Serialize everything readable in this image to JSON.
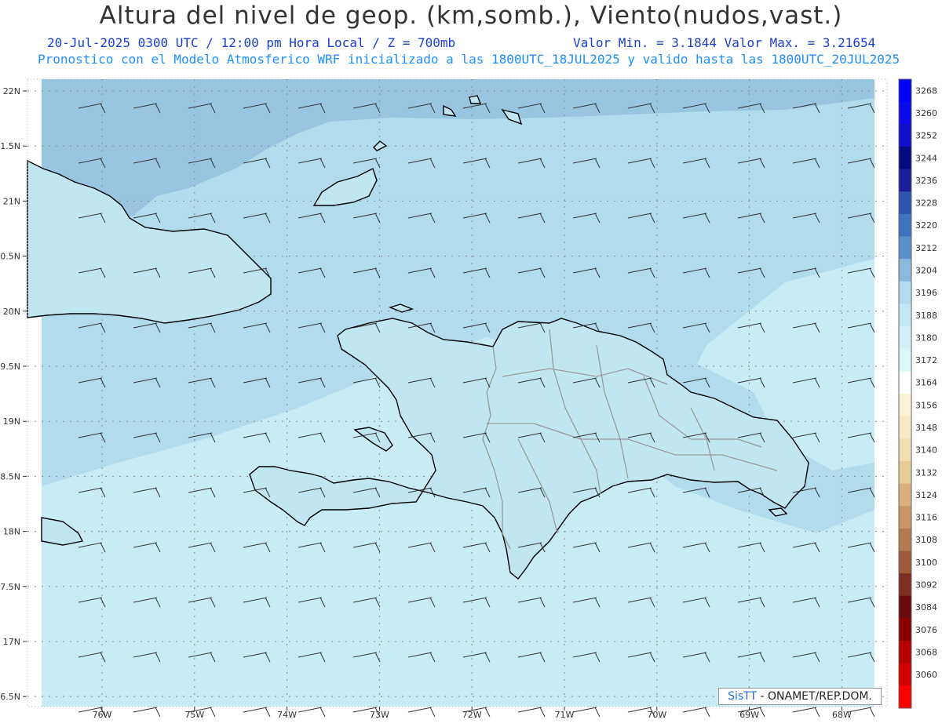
{
  "header": {
    "title": "Altura del nivel de geop. (km,somb.), Viento(nudos,vast.)",
    "subtitle_left": "20-Jul-2025  0300 UTC / 12:00 pm Hora Local / Z = 700mb",
    "subtitle_right": "Valor Min. = 3.1844  Valor Max. = 3.21654",
    "subtitle_model": "Pronostico con el Modelo Atmosferico WRF inicializado a las 1800UTC_18JUL2025 y valido hasta las  1800UTC_20JUL2025"
  },
  "axes": {
    "lat_labels": [
      "22N",
      "1.5N",
      "21N",
      "0.5N",
      "20N",
      "9.5N",
      "19N",
      "8.5N",
      "18N",
      "7.5N",
      "17N",
      "6.5N"
    ],
    "lon_labels": [
      "76W",
      "75W",
      "74W",
      "73W",
      "72W",
      "71W",
      "70W",
      "69W",
      "68W"
    ]
  },
  "colorbar": {
    "labels": [
      "3268",
      "3260",
      "3252",
      "3244",
      "3236",
      "3228",
      "3220",
      "3212",
      "3204",
      "3196",
      "3188",
      "3180",
      "3172",
      "3164",
      "3156",
      "3148",
      "3140",
      "3132",
      "3124",
      "3116",
      "3108",
      "3100",
      "3092",
      "3084",
      "3076",
      "3068",
      "3060"
    ],
    "colors": [
      "#0000ff",
      "#0a0ae8",
      "#1010c8",
      "#0a0a80",
      "#1e1e98",
      "#2e55b0",
      "#3d74bd",
      "#5a8fca",
      "#8cb8dc",
      "#b2dcee",
      "#c2e6f2",
      "#d2f0f6",
      "#d8f8fa",
      "#ffffff",
      "#fbf2d4",
      "#f6eac6",
      "#f0dfb2",
      "#e8cc98",
      "#d8b080",
      "#c8966a",
      "#b27a52",
      "#9c5c3c",
      "#7e2e22",
      "#6a0a0a",
      "#8a0000",
      "#b40000",
      "#d00000",
      "#ff0000"
    ]
  },
  "map": {
    "ocean_color": "#c8ecf4",
    "deep_color": "#8fbcd9",
    "mid_color": "#a6d3e7",
    "land_fill": "#bfe4ef"
  },
  "credit": {
    "brand": "SisTT",
    "text": "- ONAMET/REP.DOM."
  }
}
